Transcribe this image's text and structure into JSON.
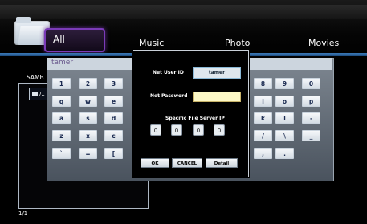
{
  "nav": {
    "items": [
      "All",
      "Music",
      "Photo",
      "Movies"
    ],
    "selected": "All"
  },
  "browser": {
    "source_label": "SAMB",
    "item_label": "/..",
    "page_indicator": "1/1"
  },
  "keyboard": {
    "input_value": "tamer",
    "rows": [
      [
        "1",
        "2",
        "3",
        "",
        "",
        "",
        "",
        "",
        "",
        "8",
        "9",
        "0"
      ],
      [
        "q",
        "w",
        "e",
        "",
        "",
        "",
        "",
        "",
        "",
        "i",
        "o",
        "p"
      ],
      [
        "a",
        "s",
        "d",
        "",
        "",
        "",
        "",
        "",
        "",
        "k",
        "l",
        "-"
      ],
      [
        "z",
        "x",
        "c",
        "",
        "",
        "",
        "",
        "",
        "",
        "/",
        "\\",
        "_"
      ],
      [
        "`",
        "=",
        "[",
        "",
        "",
        "",
        "",
        "",
        "",
        ",",
        ".",
        ""
      ]
    ]
  },
  "dialog": {
    "user_id_label": "Net User ID",
    "user_id_value": "tamer",
    "password_label": "Net Password",
    "password_value": "",
    "server_ip_label": "Specific File Server IP",
    "ip_octets": [
      "0",
      "0",
      "0",
      "0"
    ],
    "ok_label": "OK",
    "cancel_label": "CANCEL",
    "detail_label": "Detail"
  },
  "colors": {
    "accent_purple": "#7b3bb8",
    "nav_line": "#3b78b6",
    "password_field": "#fcf8c6"
  }
}
